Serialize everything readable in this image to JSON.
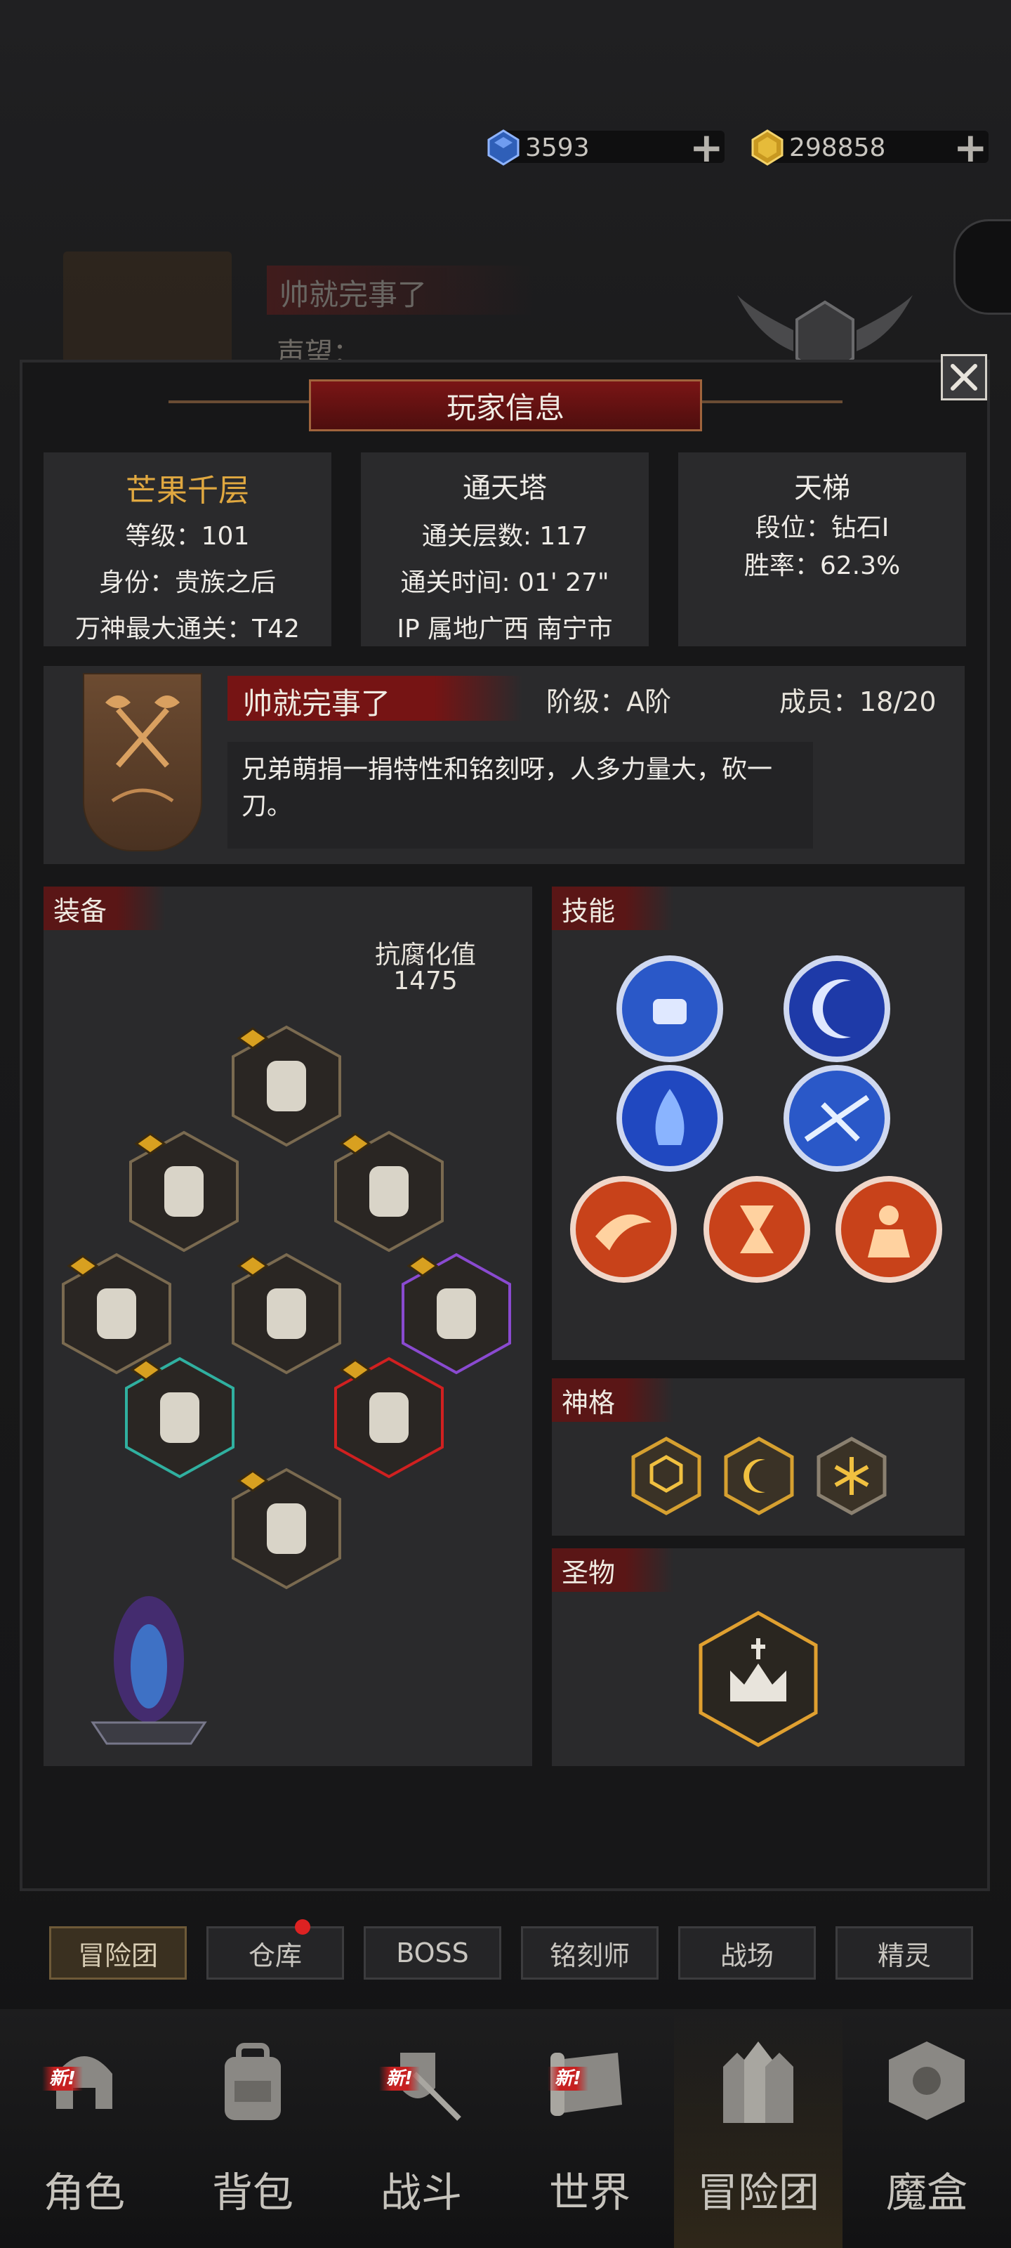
{
  "resources": {
    "gem_value": "3593",
    "gold_value": "298858",
    "gem_color": "#3c6fc8",
    "gold_color": "#e0b030"
  },
  "background": {
    "guild_name": "帅就完事了",
    "reputation_label": "声望："
  },
  "modal": {
    "title": "玩家信息",
    "player": {
      "name": "芒果千层",
      "level": "等级：101",
      "identity": "身份：贵族之后",
      "pantheon": "万神最大通关：T42"
    },
    "tower": {
      "title": "通天塔",
      "floors": "通关层数: 117",
      "time": "通关时间: 01' 27\"",
      "ip": "IP 属地广西 南宁市"
    },
    "ladder": {
      "title": "天梯",
      "rank": "段位：钻石I",
      "winrate": "胜率：62.3%"
    },
    "guild": {
      "name": "帅就完事了",
      "tier": "阶级：A阶",
      "members": "成员：18/20",
      "motto": "兄弟萌捐一捐特性和铭刻呀，人多力量大，砍一刀。"
    },
    "equipment": {
      "label": "装备",
      "resist_label": "抗腐化值",
      "resist_value": "1475",
      "slots": [
        {
          "name": "scarf-icon"
        },
        {
          "name": "gauntlet-icon"
        },
        {
          "name": "ring-icon"
        },
        {
          "name": "pants-icon"
        },
        {
          "name": "armor-icon"
        },
        {
          "name": "cloak-icon"
        },
        {
          "name": "staff-left-icon"
        },
        {
          "name": "staff-right-icon"
        },
        {
          "name": "boots-icon"
        }
      ]
    },
    "skills": {
      "label": "技能"
    },
    "godhood": {
      "label": "神格"
    },
    "relic": {
      "label": "圣物"
    }
  },
  "tabs": [
    "冒险团",
    "仓库",
    "BOSS",
    "铭刻师",
    "战场",
    "精灵"
  ],
  "nav": {
    "items": [
      "角色",
      "背包",
      "战斗",
      "世界",
      "冒险团",
      "魔盒"
    ],
    "new_label": "新!"
  }
}
